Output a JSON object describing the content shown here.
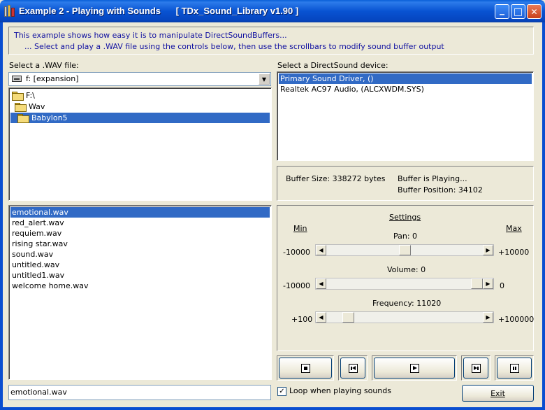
{
  "window": {
    "title": "Example 2 - Playing with Sounds      [ TDx_Sound_Library v1.90 ]",
    "minimize": "_",
    "maximize": "□",
    "close": "✕"
  },
  "description": {
    "line1": "This example shows how easy it is to manipulate DirectSoundBuffers...",
    "line2": "... Select and play a .WAV file using the controls below, then use the scrollbars to modify sound buffer output"
  },
  "file_section": {
    "label": "Select a .WAV file:",
    "drive": "f: [expansion]",
    "folders": [
      {
        "name": "F:\\",
        "selected": false
      },
      {
        "name": "Wav",
        "selected": false
      },
      {
        "name": "Babylon5",
        "selected": true
      }
    ],
    "files": [
      {
        "name": "emotional.wav",
        "selected": true
      },
      {
        "name": "red_alert.wav",
        "selected": false
      },
      {
        "name": "requiem.wav",
        "selected": false
      },
      {
        "name": "rising star.wav",
        "selected": false
      },
      {
        "name": "sound.wav",
        "selected": false
      },
      {
        "name": "untitled.wav",
        "selected": false
      },
      {
        "name": "untitled1.wav",
        "selected": false
      },
      {
        "name": "welcome home.wav",
        "selected": false
      }
    ],
    "filename": "emotional.wav"
  },
  "device_section": {
    "label": "Select a DirectSound device:",
    "devices": [
      {
        "name": "Primary Sound Driver, ()",
        "selected": true
      },
      {
        "name": "Realtek AC97 Audio, (ALCXWDM.SYS)",
        "selected": false
      }
    ]
  },
  "info": {
    "buffer_size": "Buffer Size: 338272 bytes",
    "buffer_status": "Buffer is Playing...",
    "buffer_position": "Buffer Position: 34102"
  },
  "settings": {
    "title": "Settings",
    "min_label": "Min",
    "max_label": "Max",
    "pan": {
      "label": "Pan: 0",
      "min": "-10000",
      "max": "+10000",
      "value": 0,
      "range": [
        -10000,
        10000
      ]
    },
    "volume": {
      "label": "Volume: 0",
      "min": "-10000",
      "max": "0",
      "value": 0,
      "range": [
        -10000,
        0
      ]
    },
    "frequency": {
      "label": "Frequency: 11020",
      "min": "+100",
      "max": "+100000",
      "value": 11020,
      "range": [
        100,
        100000
      ]
    }
  },
  "transport": {
    "stop_icon": "stop-icon",
    "rewind_icon": "rewind-icon",
    "play_icon": "play-icon",
    "forward_icon": "fast-forward-icon",
    "pause_icon": "pause-icon"
  },
  "loop": {
    "label": "Loop when playing sounds",
    "checked": true,
    "mark": "✓"
  },
  "exit": {
    "label": "Exit"
  },
  "colors": {
    "titlebar": "#0A5FD8",
    "selection": "#316AC5",
    "desc_text": "#1010a0",
    "face": "#ECE9D8"
  }
}
